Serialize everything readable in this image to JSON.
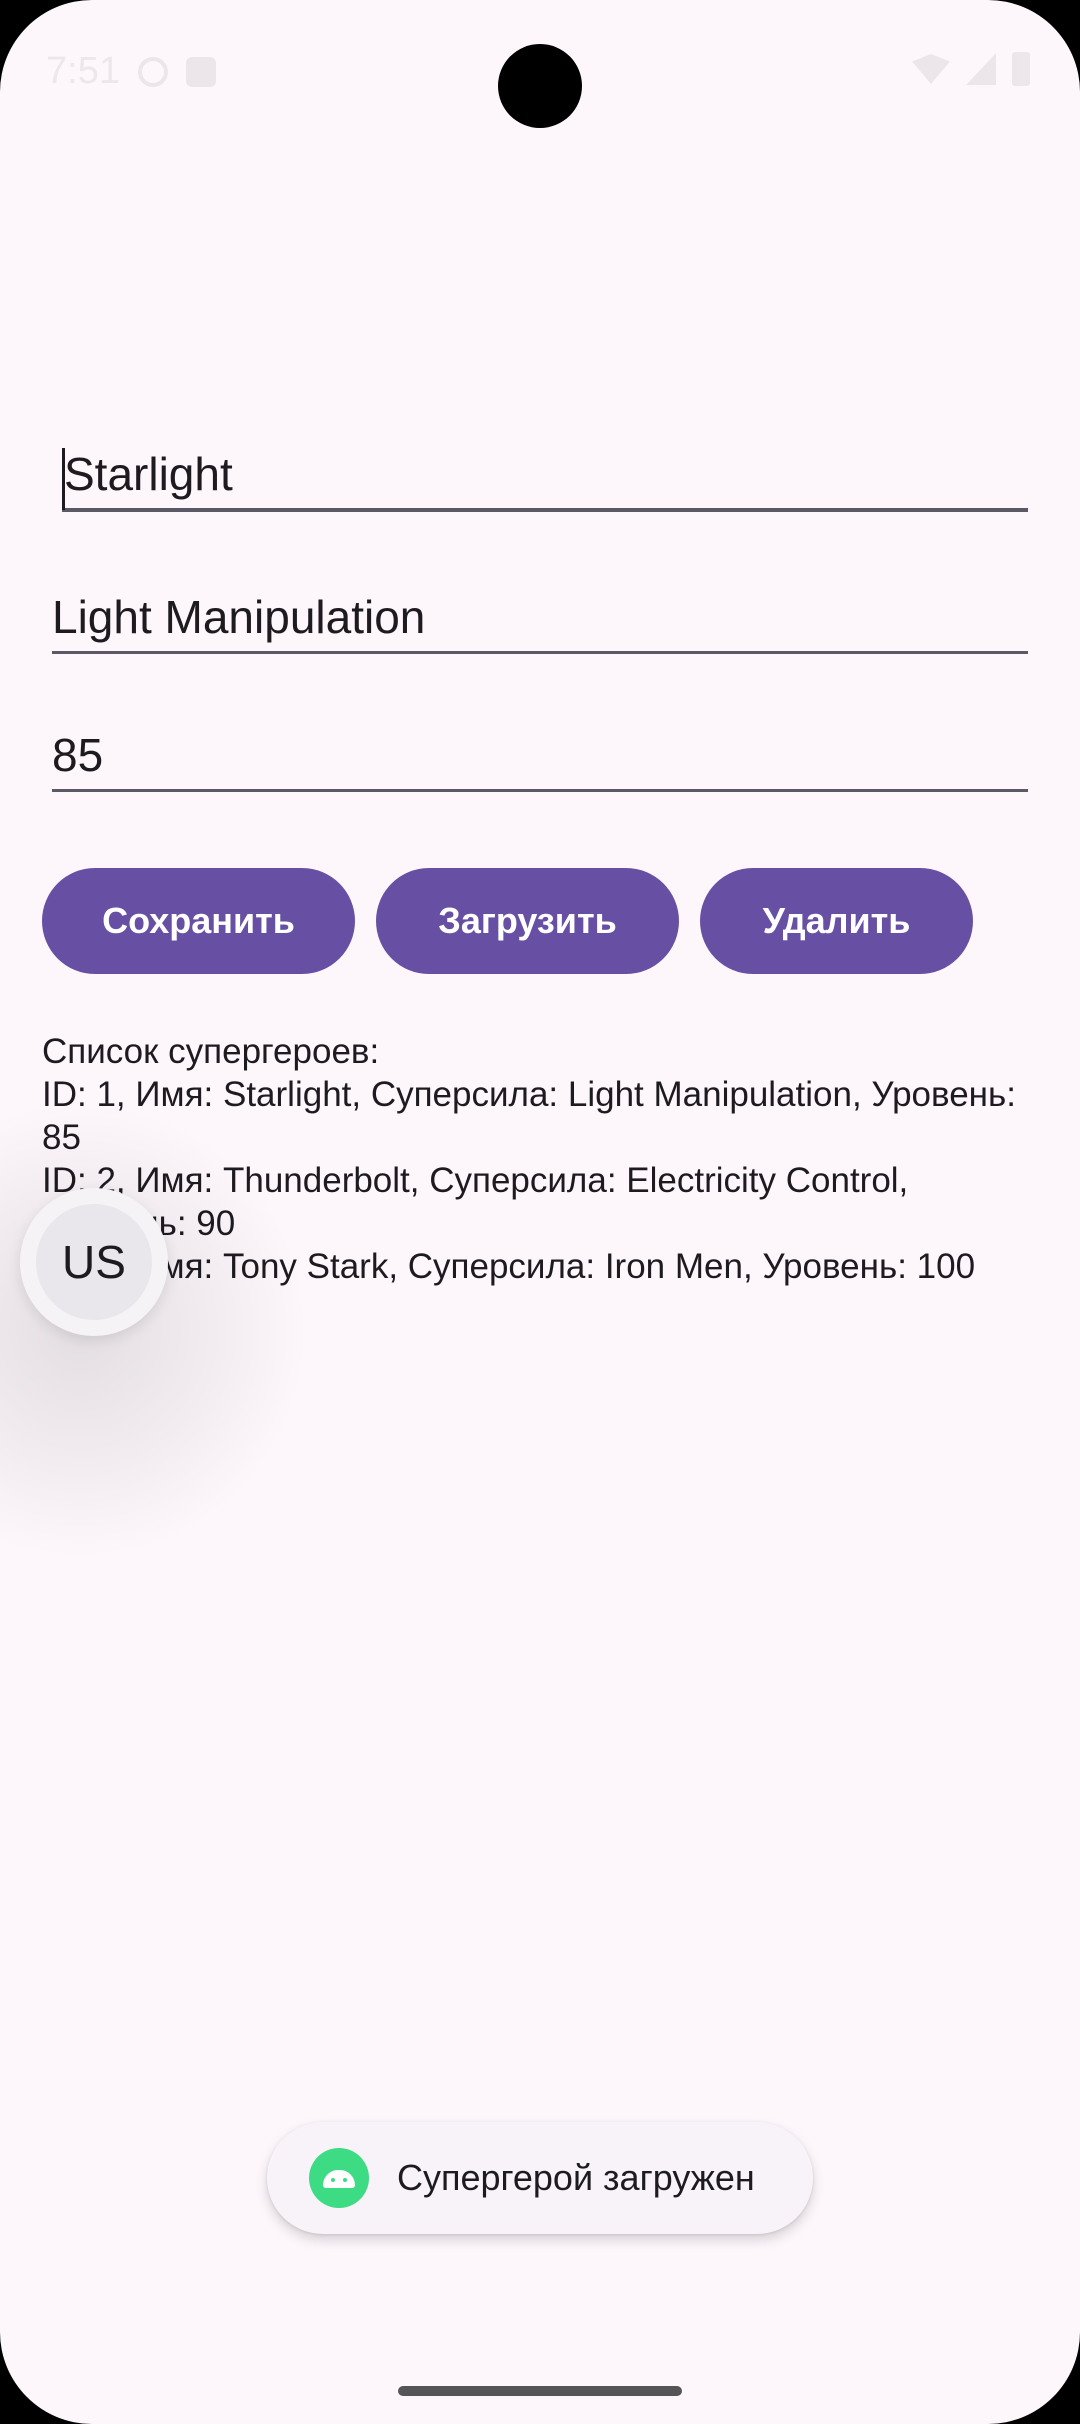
{
  "status_bar": {
    "time": "7:51"
  },
  "form": {
    "name_value": "Starlight",
    "power_value": "Light Manipulation",
    "level_value": "85"
  },
  "buttons": {
    "save": "Сохранить",
    "load": "Загрузить",
    "delete": "Удалить"
  },
  "list": {
    "header": "Список супергероев:",
    "entries": [
      "ID: 1, Имя: Starlight, Суперсила: Light Manipulation, Уровень: 85",
      "ID: 2, Имя: Thunderbolt, Суперсила: Electricity Control, Уровень: 90",
      "ID: 3, Имя: Tony Stark, Суперсила: Iron Men, Уровень: 100"
    ]
  },
  "floating_bubble": {
    "label": "US"
  },
  "toast": {
    "message": "Супергерой загружен",
    "icon": "android-icon"
  },
  "colors": {
    "background": "#fdf7fc",
    "accent": "#6750a4"
  }
}
